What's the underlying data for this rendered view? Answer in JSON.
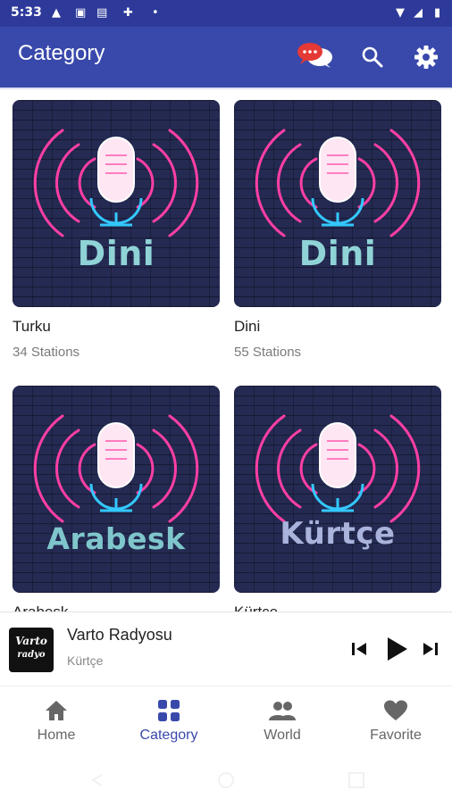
{
  "status_bar": {
    "time": "5:33"
  },
  "app_bar": {
    "title": "Category"
  },
  "categories": [
    {
      "name": "Turku",
      "count": "34 Stations",
      "art_text": "Dini",
      "art_color": "#8fd3d6"
    },
    {
      "name": "Dini",
      "count": "55 Stations",
      "art_text": "Dini",
      "art_color": "#8fd3d6"
    },
    {
      "name": "Arabesk",
      "count": "",
      "art_text": "Arabesk",
      "art_color": "#7fc6cc"
    },
    {
      "name": "Kürtçe",
      "count": "",
      "art_text": "Kürtçe",
      "art_color": "#a9b3dc"
    }
  ],
  "player": {
    "title": "Varto Radyosu",
    "subtitle": "Kürtçe",
    "logo_top": "Varto",
    "logo_bottom": "radyo"
  },
  "bottom_nav": {
    "home": "Home",
    "category": "Category",
    "world": "World",
    "favorite": "Favorite"
  },
  "colors": {
    "primary": "#3949ab",
    "status_bar": "#2d3a9a",
    "neon_pink": "#ff3fa4",
    "neon_blue": "#33c8ff"
  },
  "icons": [
    "chat-icon",
    "search-icon",
    "gear-icon",
    "previous-icon",
    "play-icon",
    "next-icon",
    "home-icon",
    "grid-icon",
    "people-icon",
    "heart-icon"
  ]
}
